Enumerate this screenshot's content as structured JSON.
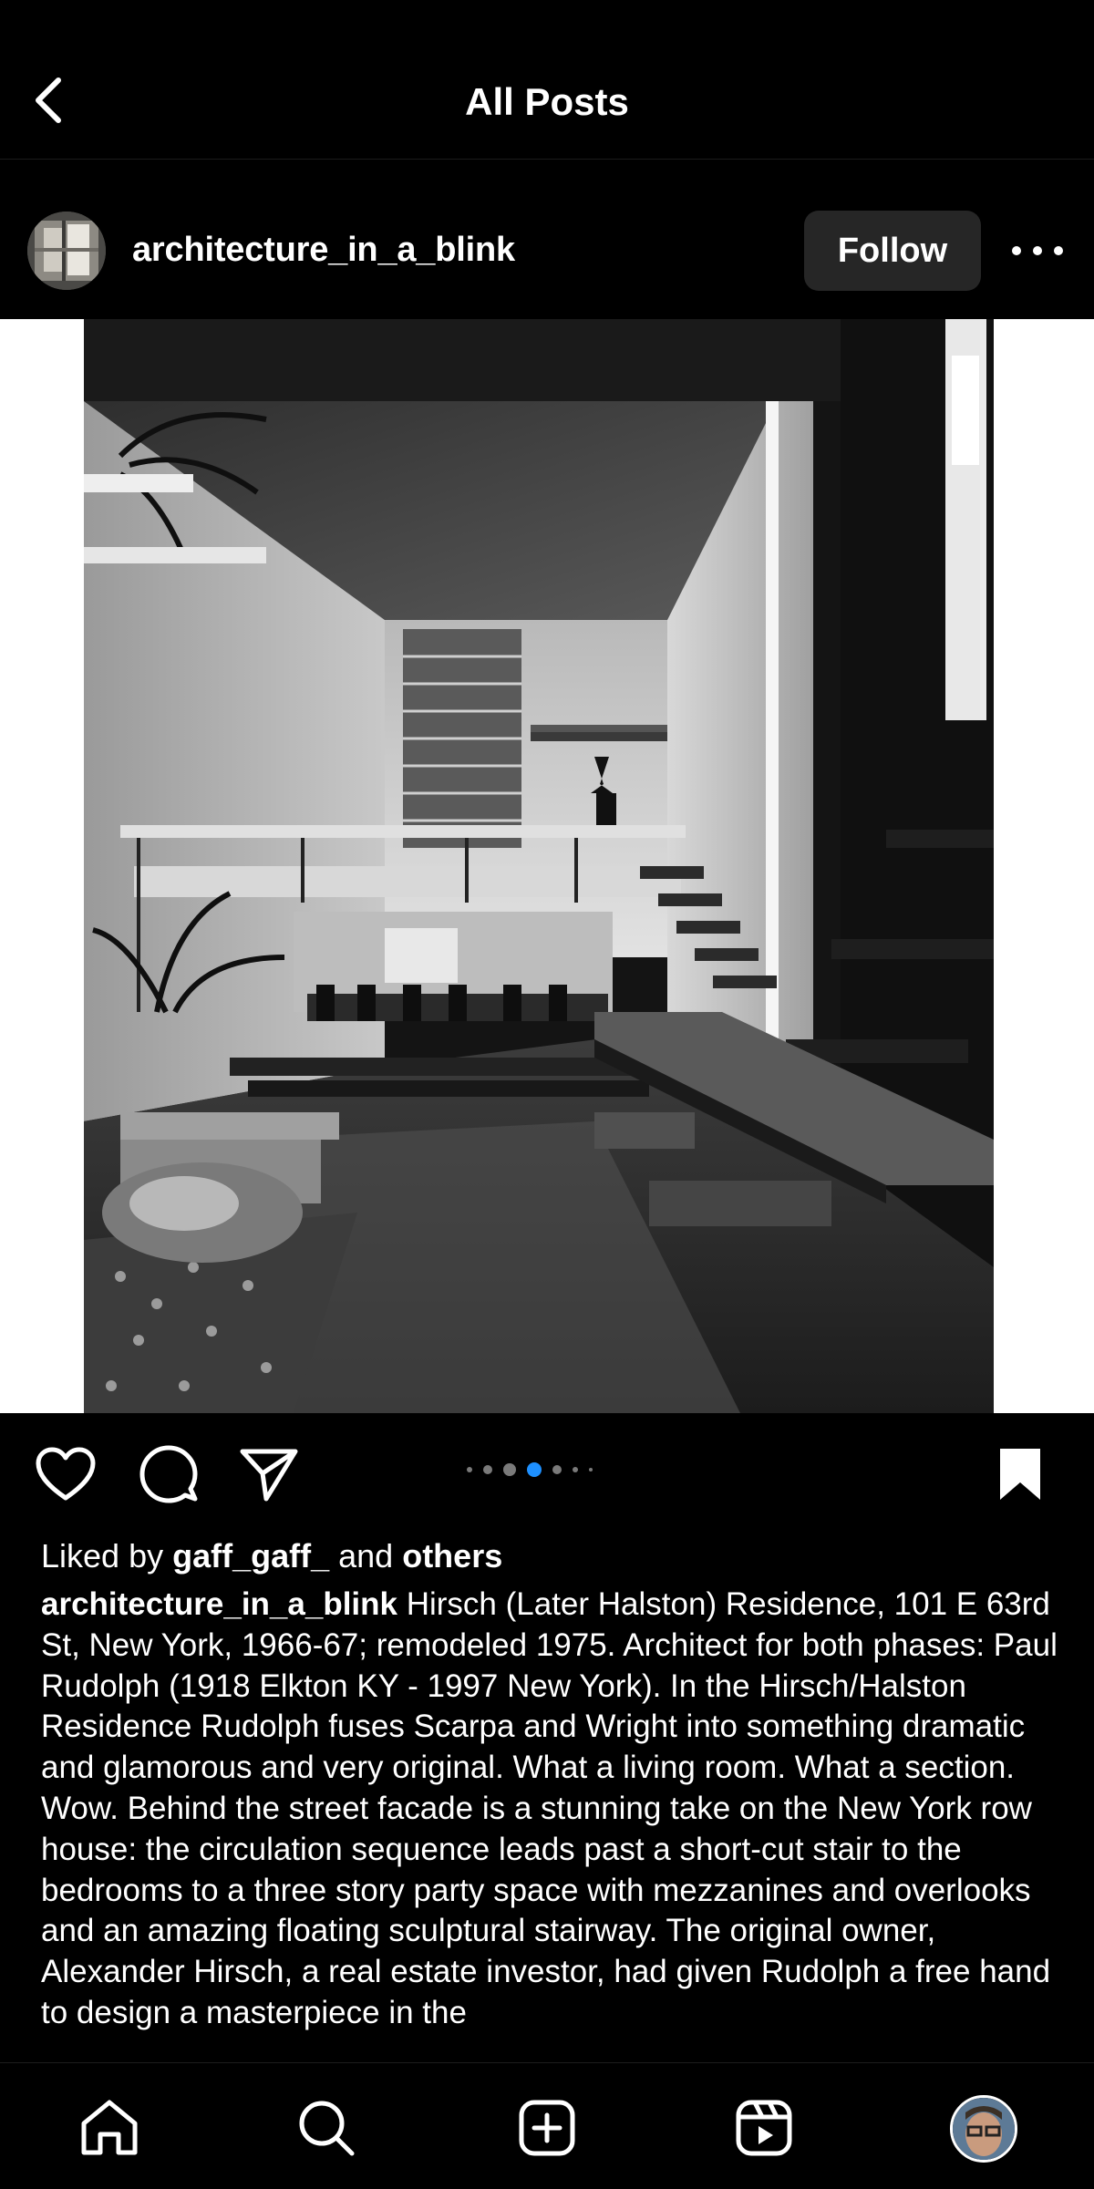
{
  "header": {
    "title": "All Posts",
    "back_icon": "chevron-left-icon"
  },
  "post": {
    "username": "architecture_in_a_blink",
    "follow_label": "Follow",
    "more_icon": "more-horizontal-icon",
    "image_description_icon": "photo",
    "carousel": {
      "count": 7,
      "active_index": 3
    },
    "liked_by_prefix": "Liked by ",
    "liked_by_user": "gaff_gaff_",
    "liked_by_middle": " and ",
    "liked_by_others": "others",
    "caption_user": "architecture_in_a_blink",
    "caption_text": " Hirsch (Later Halston) Residence, 101 E 63rd St, New York, 1966-67; remodeled 1975. Architect for both phases: Paul Rudolph (1918 Elkton KY - 1997 New York). In the Hirsch/Halston Residence Rudolph fuses Scarpa and Wright into something dramatic and glamorous and very original. What a living room. What a section. Wow. Behind the street facade is a stunning take on the New York row house: the circulation sequence leads past a short-cut stair to the bedrooms to a three story party space with mezzanines and overlooks and an amazing floating sculptural stairway. The original owner, Alexander Hirsch, a real estate investor, had given Rudolph a free hand to design a masterpiece in the"
  },
  "actions": [
    "heart-icon",
    "comment-icon",
    "share-icon",
    "bookmark-icon"
  ],
  "tabbar": [
    "home-icon",
    "search-icon",
    "new-post-icon",
    "reels-icon",
    "profile-avatar"
  ],
  "colors": {
    "background": "#000000",
    "button": "#262626",
    "active_dot": "#1e90ff"
  }
}
